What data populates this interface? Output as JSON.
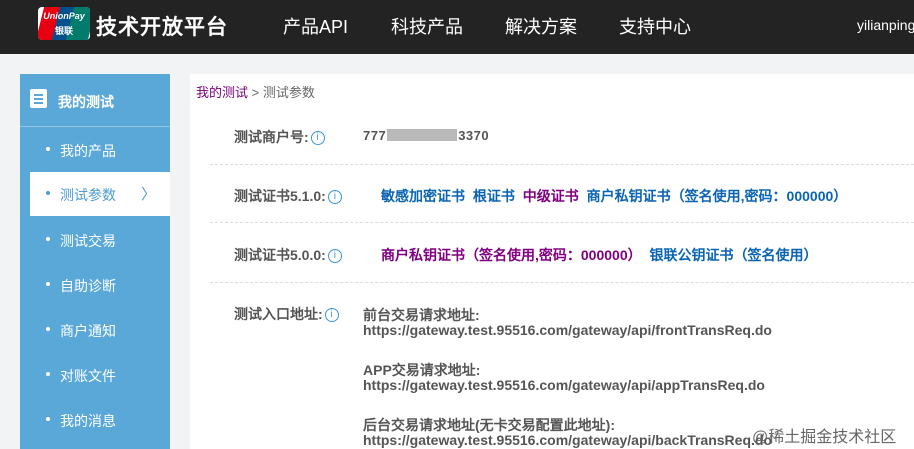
{
  "header": {
    "logo_top": "UnionPay",
    "logo_bottom": "银联",
    "brand": "技术开放平台",
    "nav": [
      "产品API",
      "科技产品",
      "解决方案",
      "支持中心"
    ],
    "user": "yilianping"
  },
  "sidebar": {
    "title": "我的测试",
    "items": [
      {
        "label": "我的产品"
      },
      {
        "label": "测试参数"
      },
      {
        "label": "测试交易"
      },
      {
        "label": "自助诊断"
      },
      {
        "label": "商户通知"
      },
      {
        "label": "对账文件"
      },
      {
        "label": "我的消息"
      }
    ],
    "active_chevron": "〉"
  },
  "breadcrumb": {
    "root": "我的测试",
    "sep": ">",
    "current": "测试参数"
  },
  "merchant": {
    "label": "测试商户号:",
    "prefix": "777",
    "suffix": "3370"
  },
  "cert510": {
    "label": "测试证书5.1.0:",
    "links": [
      "敏感加密证书",
      "根证书",
      "中级证书",
      "商户私钥证书（签名使用,密码：000000）"
    ]
  },
  "cert500": {
    "label": "测试证书5.0.0:",
    "links": [
      "商户私钥证书（签名使用,密码：000000）",
      "银联公钥证书（签名使用）"
    ]
  },
  "endpoints": {
    "label": "测试入口地址:",
    "items": [
      {
        "label": "前台交易请求地址:",
        "url": "https://gateway.test.95516.com/gateway/api/frontTransReq.do"
      },
      {
        "label": "APP交易请求地址:",
        "url": "https://gateway.test.95516.com/gateway/api/appTransReq.do"
      },
      {
        "label": "后台交易请求地址(无卡交易配置此地址):",
        "url": "https://gateway.test.95516.com/gateway/api/backTransReq.do"
      }
    ]
  },
  "watermark": "@稀土掘金技术社区",
  "colors": {
    "topbar": "#232323",
    "sidebar": "#5aa8d8",
    "link_blue": "#0a64b4",
    "link_purple": "#800080"
  }
}
